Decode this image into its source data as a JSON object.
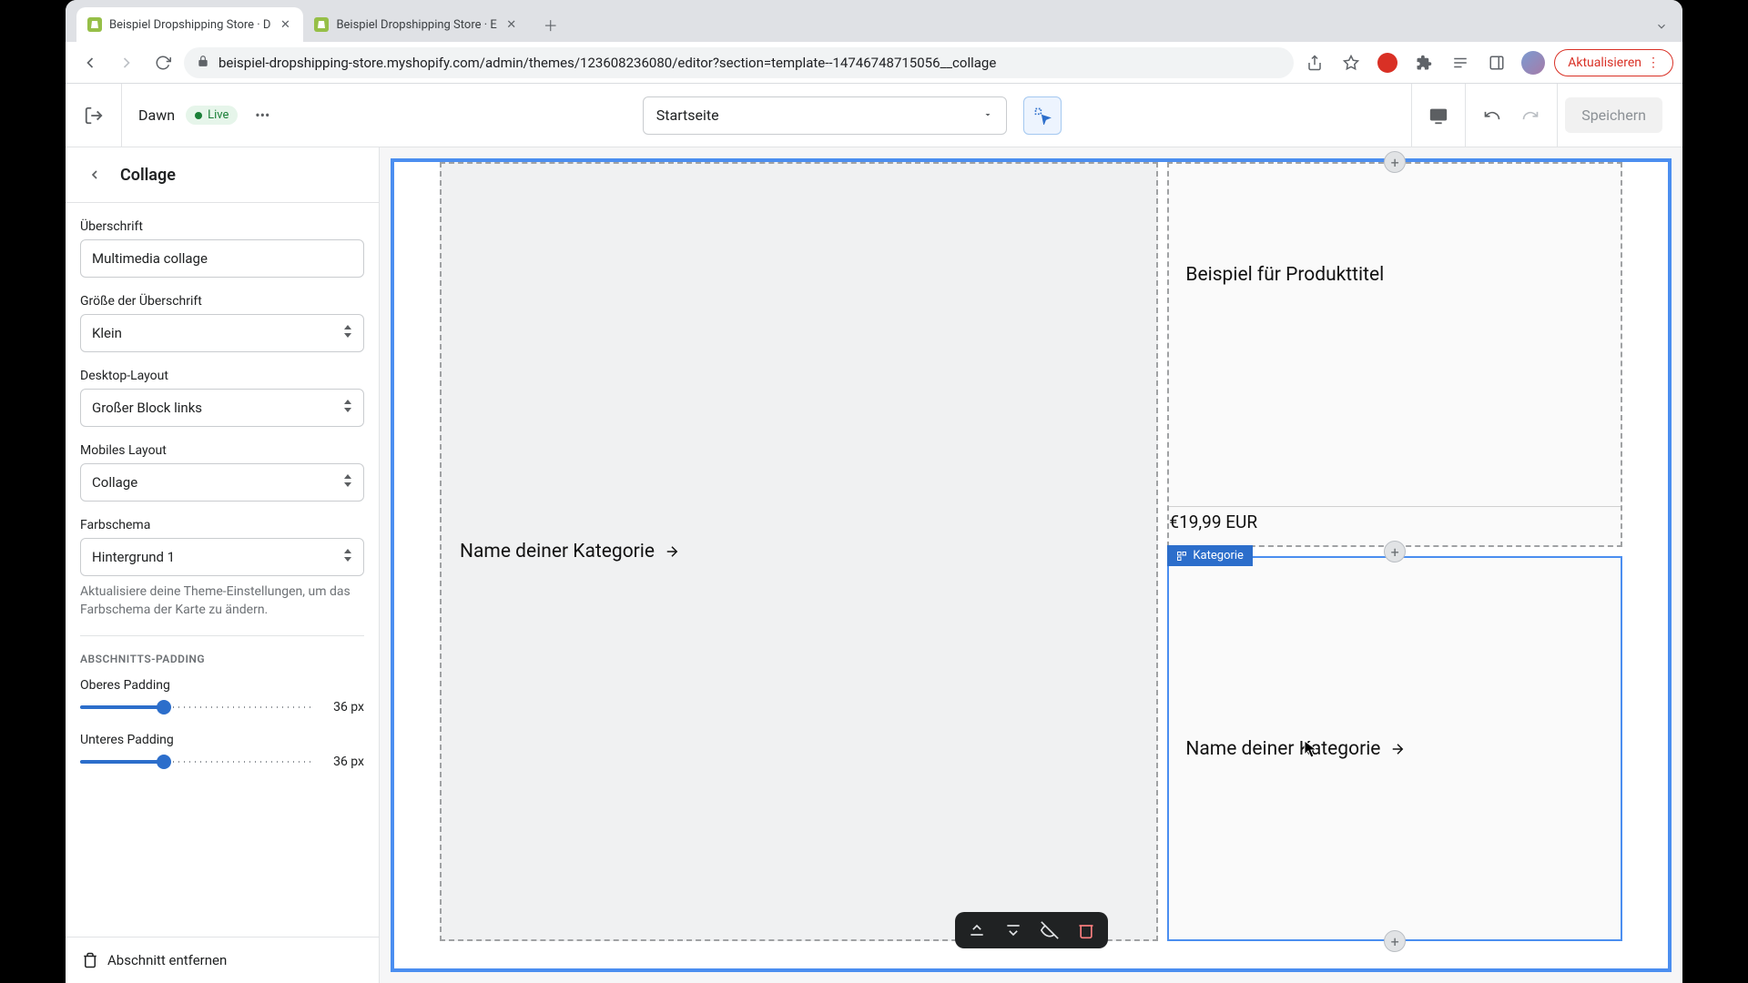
{
  "browser": {
    "tabs": [
      {
        "title": "Beispiel Dropshipping Store · D"
      },
      {
        "title": "Beispiel Dropshipping Store · E"
      }
    ],
    "url": "beispiel-dropshipping-store.myshopify.com/admin/themes/123608236080/editor?section=template--14746748715056__collage",
    "update_label": "Aktualisieren"
  },
  "editor_top": {
    "theme_name": "Dawn",
    "live_label": "Live",
    "page_selector": "Startseite",
    "save_label": "Speichern"
  },
  "settings": {
    "title": "Collage",
    "fields": {
      "heading_label": "Überschrift",
      "heading_value": "Multimedia collage",
      "heading_size_label": "Größe der Überschrift",
      "heading_size_value": "Klein",
      "desktop_layout_label": "Desktop-Layout",
      "desktop_layout_value": "Großer Block links",
      "mobile_layout_label": "Mobiles Layout",
      "mobile_layout_value": "Collage",
      "color_scheme_label": "Farbschema",
      "color_scheme_value": "Hintergrund 1",
      "color_scheme_help": "Aktualisiere deine Theme-Einstellungen, um das Farbschema der Karte zu ändern.",
      "padding_section": "ABSCHNITTS-PADDING",
      "padding_top_label": "Oberes Padding",
      "padding_top_value": "36 px",
      "padding_bottom_label": "Unteres Padding",
      "padding_bottom_value": "36 px"
    },
    "remove_label": "Abschnitt entfernen"
  },
  "canvas": {
    "big_category": "Name deiner Kategorie",
    "product_title": "Beispiel für Produkttitel",
    "product_price": "€19,99 EUR",
    "kategorie_badge": "Kategorie",
    "small_category": "Name deiner Kategorie"
  }
}
